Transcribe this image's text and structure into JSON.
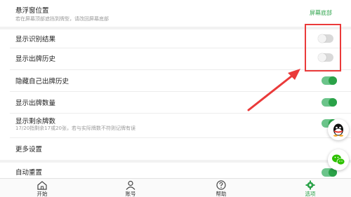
{
  "floating_position": {
    "title": "悬浮窗位置",
    "subtitle": "若在屏幕顶部遮挡到牌型，请改回屏幕底部",
    "value": "屏幕底部"
  },
  "settings": [
    {
      "key": "show_recognition",
      "title": "显示识别结果",
      "subtitle": "",
      "enabled": false
    },
    {
      "key": "show_history",
      "title": "显示出牌历史",
      "subtitle": "",
      "enabled": false
    },
    {
      "key": "hide_own_history",
      "title": "隐藏自己出牌历史",
      "subtitle": "",
      "enabled": true
    },
    {
      "key": "show_count",
      "title": "显示出牌数量",
      "subtitle": "",
      "enabled": true
    },
    {
      "key": "show_remaining",
      "title": "显示剩余牌数",
      "subtitle": "17/20指剩余17或20张，若与实际牌数不符则记牌有误",
      "enabled": true
    }
  ],
  "more_settings": {
    "title": "更多设置"
  },
  "auto_reset": {
    "title": "自动重置",
    "enabled": true
  },
  "side_buttons": {
    "qq": "qq-icon",
    "wechat": "wechat-icon"
  },
  "tabbar": {
    "tabs": [
      {
        "label": "开始",
        "icon": "home-icon",
        "active": false
      },
      {
        "label": "账号",
        "icon": "user-icon",
        "active": false
      },
      {
        "label": "帮助",
        "icon": "help-icon",
        "active": false
      },
      {
        "label": "选项",
        "icon": "settings-icon",
        "active": true
      }
    ]
  },
  "colors": {
    "accent": "#2aa248",
    "annotation": "#ea3a3a"
  }
}
